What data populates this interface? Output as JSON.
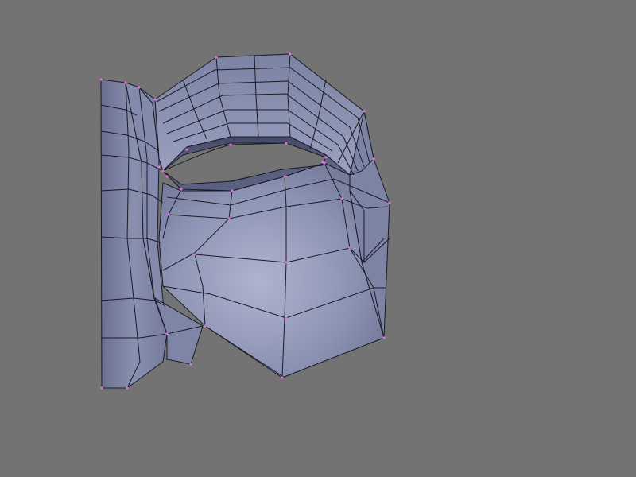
{
  "viewport": {
    "background": "#737373",
    "mesh_fill_light": "#9ba1bd",
    "mesh_fill_mid": "#7c81a1",
    "mesh_fill_dark": "#5d6282",
    "edge_color": "#1a1a26",
    "vertex_color": "#e070e8"
  }
}
